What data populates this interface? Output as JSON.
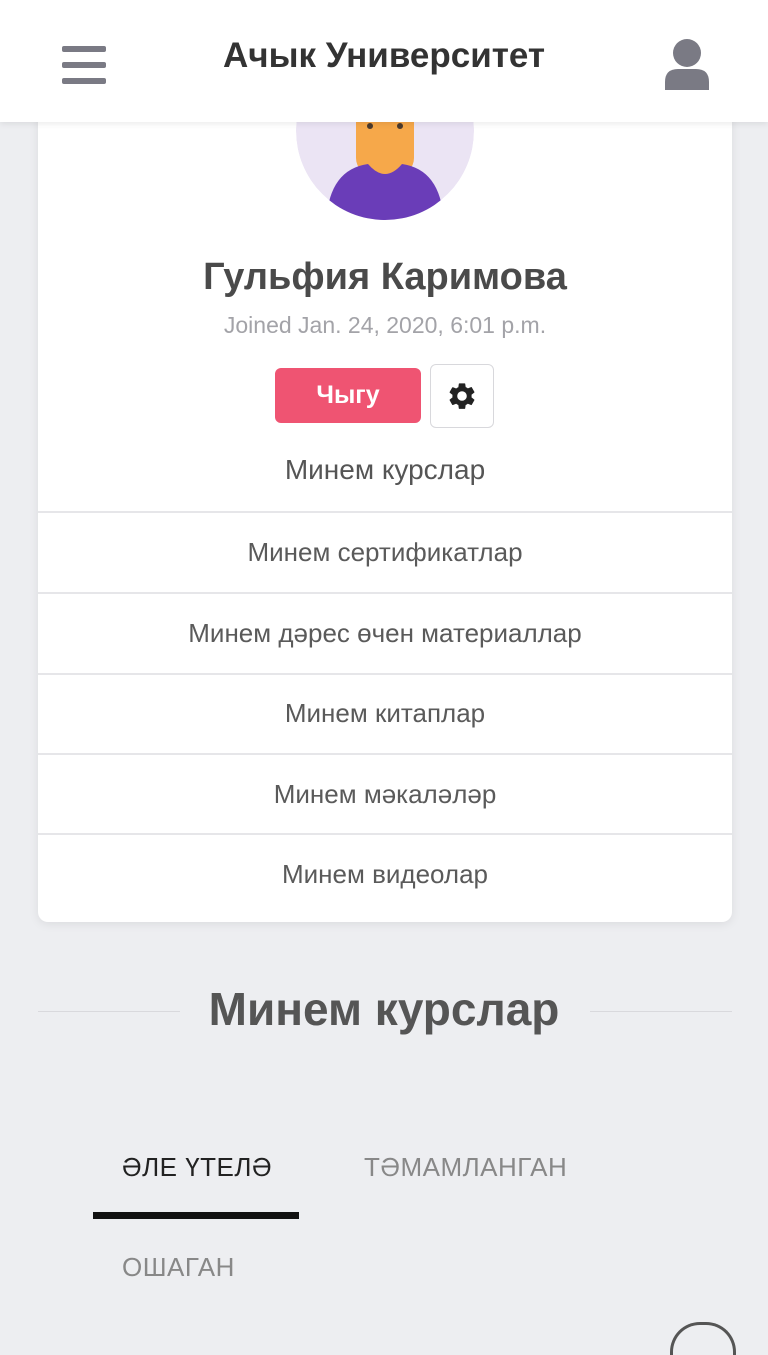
{
  "header": {
    "title": "Ачык Университет",
    "menu_icon": "hamburger-menu-icon",
    "user_icon": "user-profile-icon"
  },
  "profile": {
    "name": "Гульфия Каримова",
    "joined": "Joined Jan. 24, 2020, 6:01 p.m.",
    "logout_label": "Чыгу",
    "settings_icon": "gear-icon",
    "menu": [
      {
        "label": "Минем курслар"
      },
      {
        "label": "Минем сертификатлар"
      },
      {
        "label": "Минем дәрес өчен материаллар"
      },
      {
        "label": "Минем китаплар"
      },
      {
        "label": "Минем мәкаләләр"
      },
      {
        "label": "Минем видеолар"
      }
    ]
  },
  "courses_section": {
    "title": "Минем курслар",
    "tabs": [
      {
        "label": "ӘЛЕ ҮТЕЛӘ",
        "active": true
      },
      {
        "label": "ТӘМАМЛАНГАН",
        "active": false
      },
      {
        "label": "ОШАГАН",
        "active": false
      }
    ]
  },
  "colors": {
    "accent": "#ef5472",
    "background": "#edeef1",
    "avatar_bg": "#ebe4f4",
    "avatar_shirt": "#6a3db8",
    "avatar_skin": "#f6a84a"
  }
}
